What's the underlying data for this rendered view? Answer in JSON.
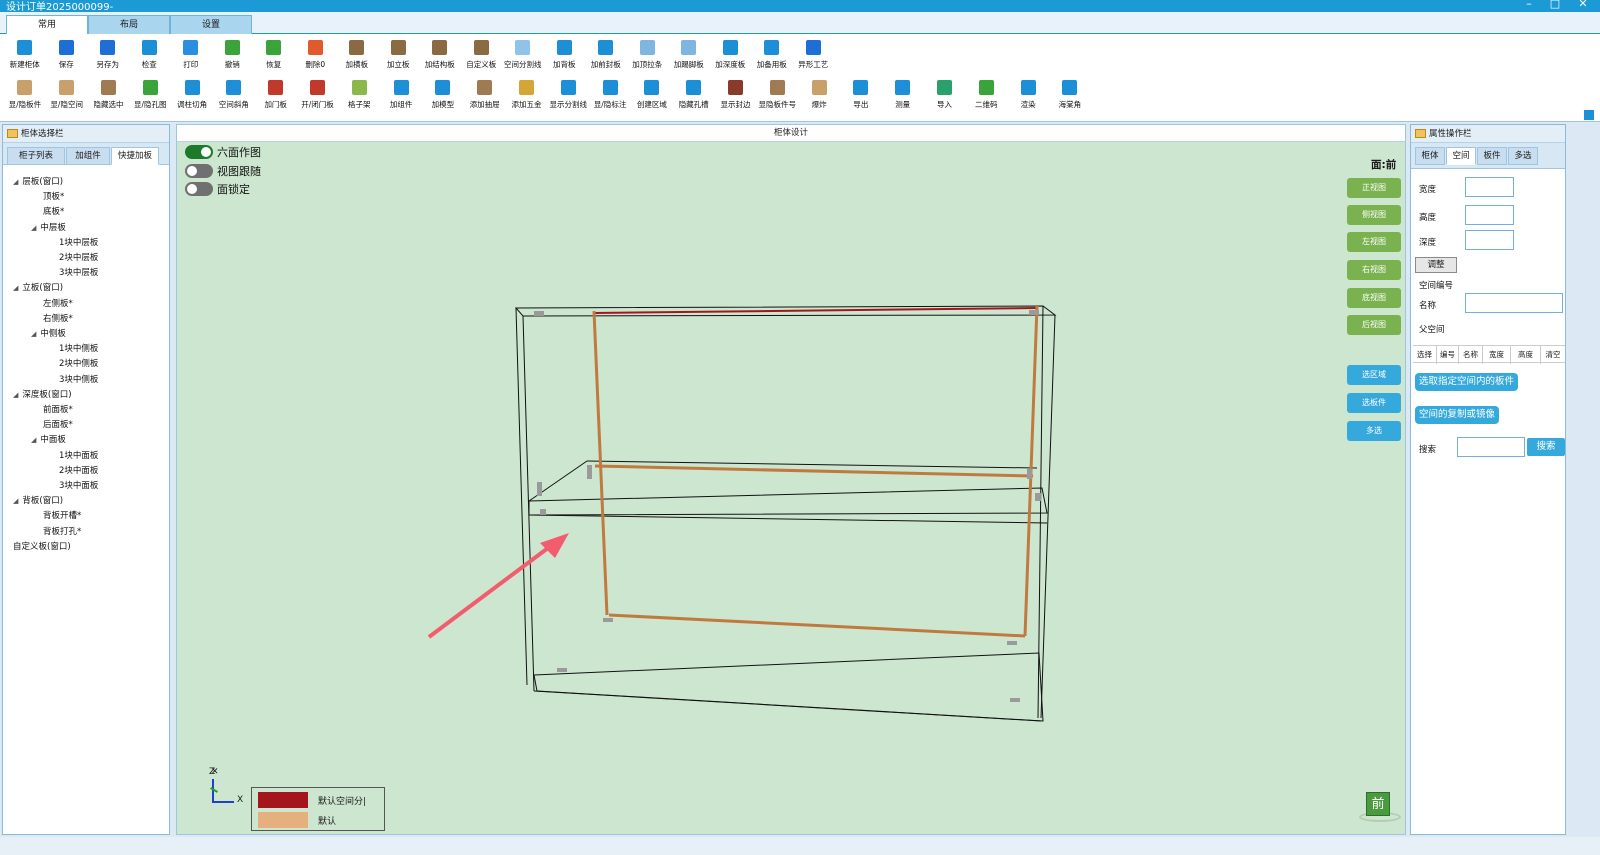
{
  "window": {
    "title": "设计订单2025000099-",
    "min": "–",
    "max": "□",
    "close": "✕"
  },
  "ribbon_tabs": [
    "常用",
    "布局",
    "设置"
  ],
  "ribbon_row1": [
    {
      "label": "新建柜体",
      "icon": "new-cabinet-icon",
      "color": "#1d8fd6"
    },
    {
      "label": "保存",
      "icon": "save-icon",
      "color": "#1d6fd6"
    },
    {
      "label": "另存为",
      "icon": "save-as-icon",
      "color": "#1d6fd6"
    },
    {
      "label": "检查",
      "icon": "check-icon",
      "color": "#1d8fd6"
    },
    {
      "label": "打印",
      "icon": "print-icon",
      "color": "#2a8fe0"
    },
    {
      "label": "撤销",
      "icon": "undo-icon",
      "color": "#3aa33a"
    },
    {
      "label": "恢复",
      "icon": "redo-icon",
      "color": "#3aa33a"
    },
    {
      "label": "删除0",
      "icon": "delete-icon",
      "color": "#e05a2b"
    },
    {
      "label": "加横板",
      "icon": "add-horizontal-board-icon",
      "color": "#8a6a42"
    },
    {
      "label": "加立板",
      "icon": "add-vertical-board-icon",
      "color": "#8a6a42"
    },
    {
      "label": "加结构板",
      "icon": "add-structure-board-icon",
      "color": "#8a6a42"
    },
    {
      "label": "自定义板",
      "icon": "custom-board-icon",
      "color": "#8a6a42"
    },
    {
      "label": "空间分割线",
      "icon": "space-divider-icon",
      "color": "#8fc4ea"
    },
    {
      "label": "加背板",
      "icon": "add-back-board-icon",
      "color": "#1d8fd6"
    },
    {
      "label": "加前封板",
      "icon": "add-front-seal-icon",
      "color": "#1d8fd6"
    },
    {
      "label": "加顶拉条",
      "icon": "add-top-strip-icon",
      "color": "#7fb6e0"
    },
    {
      "label": "加踢脚板",
      "icon": "add-kickboard-icon",
      "color": "#7fb6e0"
    },
    {
      "label": "加深度板",
      "icon": "add-depth-board-icon",
      "color": "#1d8fd6"
    },
    {
      "label": "加备用板",
      "icon": "add-spare-board-icon",
      "color": "#1d8fd6"
    },
    {
      "label": "异形工艺",
      "icon": "special-shape-icon",
      "color": "#1d6fd6"
    }
  ],
  "ribbon_row2": [
    {
      "label": "显/隐板件",
      "icon": "toggle-board-icon",
      "color": "#c8a06a"
    },
    {
      "label": "显/隐空间",
      "icon": "toggle-space-icon",
      "color": "#c8a06a"
    },
    {
      "label": "隐藏选中",
      "icon": "hide-selected-icon",
      "color": "#a07a50"
    },
    {
      "label": "显/隐孔图",
      "icon": "toggle-hole-icon",
      "color": "#3aa33a"
    },
    {
      "label": "调柱切角",
      "icon": "column-corner-icon",
      "color": "#1d8fd6"
    },
    {
      "label": "空间斜角",
      "icon": "space-bevel-icon",
      "color": "#1d8fd6"
    },
    {
      "label": "加门板",
      "icon": "add-door-icon",
      "color": "#c0392b"
    },
    {
      "label": "开/闭门板",
      "icon": "open-close-door-icon",
      "color": "#c0392b"
    },
    {
      "label": "格子架",
      "icon": "grid-rack-icon",
      "color": "#8ab84a"
    },
    {
      "label": "加组件",
      "icon": "add-component-icon",
      "color": "#1d8fd6"
    },
    {
      "label": "加模型",
      "icon": "add-model-icon",
      "color": "#1d8fd6"
    },
    {
      "label": "添加抽屉",
      "icon": "add-drawer-icon",
      "color": "#a07a50"
    },
    {
      "label": "添加五金",
      "icon": "add-hardware-icon",
      "color": "#d4a537"
    },
    {
      "label": "显示分割线",
      "icon": "show-divider-icon",
      "color": "#1d8fd6"
    },
    {
      "label": "显/隐标注",
      "icon": "toggle-dimension-icon",
      "color": "#1d8fd6"
    },
    {
      "label": "创建区域",
      "icon": "create-area-icon",
      "color": "#1d8fd6"
    },
    {
      "label": "隐藏孔槽",
      "icon": "hide-slot-icon",
      "color": "#1d8fd6"
    },
    {
      "label": "显示封边",
      "icon": "show-edge-icon",
      "color": "#8a3a2a"
    },
    {
      "label": "显隐板件号",
      "icon": "board-number-icon",
      "color": "#a07a50"
    },
    {
      "label": "爆炸",
      "icon": "explode-icon",
      "color": "#c8a06a"
    },
    {
      "label": "导出",
      "icon": "export-icon",
      "color": "#1d8fd6"
    },
    {
      "label": "测量",
      "icon": "measure-icon",
      "color": "#1d8fd6"
    },
    {
      "label": "导入",
      "icon": "import-icon",
      "color": "#2aa06a"
    },
    {
      "label": "二维码",
      "icon": "qrcode-cloud-icon",
      "color": "#3aa33a"
    },
    {
      "label": "渲染",
      "icon": "render-icon",
      "color": "#1d8fd6"
    },
    {
      "label": "海棠角",
      "icon": "begonia-corner-icon",
      "color": "#1d8fd6"
    }
  ],
  "left_panel": {
    "title": "柜体选择栏",
    "tabs": [
      "柜子列表",
      "加组件",
      "快捷加板"
    ],
    "tree": [
      {
        "label": "层板(窗口)",
        "level": 0,
        "arrow": "◢"
      },
      {
        "label": "顶板*",
        "level": 2
      },
      {
        "label": "底板*",
        "level": 2
      },
      {
        "label": "中层板",
        "level": 1,
        "arrow": "◢"
      },
      {
        "label": "1块中层板",
        "level": 3
      },
      {
        "label": "2块中层板",
        "level": 3
      },
      {
        "label": "3块中层板",
        "level": 3
      },
      {
        "label": "立板(窗口)",
        "level": 0,
        "arrow": "◢"
      },
      {
        "label": "左侧板*",
        "level": 2
      },
      {
        "label": "右侧板*",
        "level": 2
      },
      {
        "label": "中侧板",
        "level": 1,
        "arrow": "◢"
      },
      {
        "label": "1块中侧板",
        "level": 3
      },
      {
        "label": "2块中侧板",
        "level": 3
      },
      {
        "label": "3块中侧板",
        "level": 3
      },
      {
        "label": "深度板(窗口)",
        "level": 0,
        "arrow": "◢"
      },
      {
        "label": "前面板*",
        "level": 2
      },
      {
        "label": "后面板*",
        "level": 2
      },
      {
        "label": "中面板",
        "level": 1,
        "arrow": "◢"
      },
      {
        "label": "1块中面板",
        "level": 3
      },
      {
        "label": "2块中面板",
        "level": 3
      },
      {
        "label": "3块中面板",
        "level": 3
      },
      {
        "label": "背板(窗口)",
        "level": 0,
        "arrow": "◢"
      },
      {
        "label": "背板开槽*",
        "level": 2
      },
      {
        "label": "背板打孔*",
        "level": 2
      },
      {
        "label": "自定义板(窗口)",
        "level": 0
      }
    ]
  },
  "viewport": {
    "title": "柜体设计",
    "toggles": [
      {
        "label": "六面作图",
        "on": true
      },
      {
        "label": "视图跟随",
        "on": false
      },
      {
        "label": "面锁定",
        "on": false
      }
    ],
    "face_label": "面:前",
    "view_buttons": [
      "正视图",
      "侧视图",
      "左视图",
      "右视图",
      "底视图",
      "后视图"
    ],
    "select_buttons": [
      "选区域",
      "选板件",
      "多选"
    ],
    "axis": {
      "z": "Z",
      "x": "X"
    },
    "legend": [
      {
        "label": "默认空间分|",
        "color": "#a4161c"
      },
      {
        "label": "默认",
        "color": "#e6b07e"
      }
    ],
    "cube_label": "前"
  },
  "right_panel": {
    "title": "属性操作栏",
    "tabs": [
      "柜体",
      "空间",
      "板件",
      "多选"
    ],
    "width_label": "宽度",
    "width_value": "",
    "height_label": "高度",
    "height_value": "",
    "depth_label": "深度",
    "depth_value": "",
    "adjust_button": "调整",
    "space_no_label": "空间编号",
    "name_label": "名称",
    "name_value": "",
    "parent_label": "父空间",
    "table_headers": [
      "选择",
      "编号",
      "名称",
      "宽度",
      "高度",
      "清空"
    ],
    "select_boards_button": "选取指定空间内的板件",
    "copy_mirror_button": "空间的复制或镜像",
    "search_label": "搜索",
    "search_value": "",
    "search_button": "搜索"
  }
}
